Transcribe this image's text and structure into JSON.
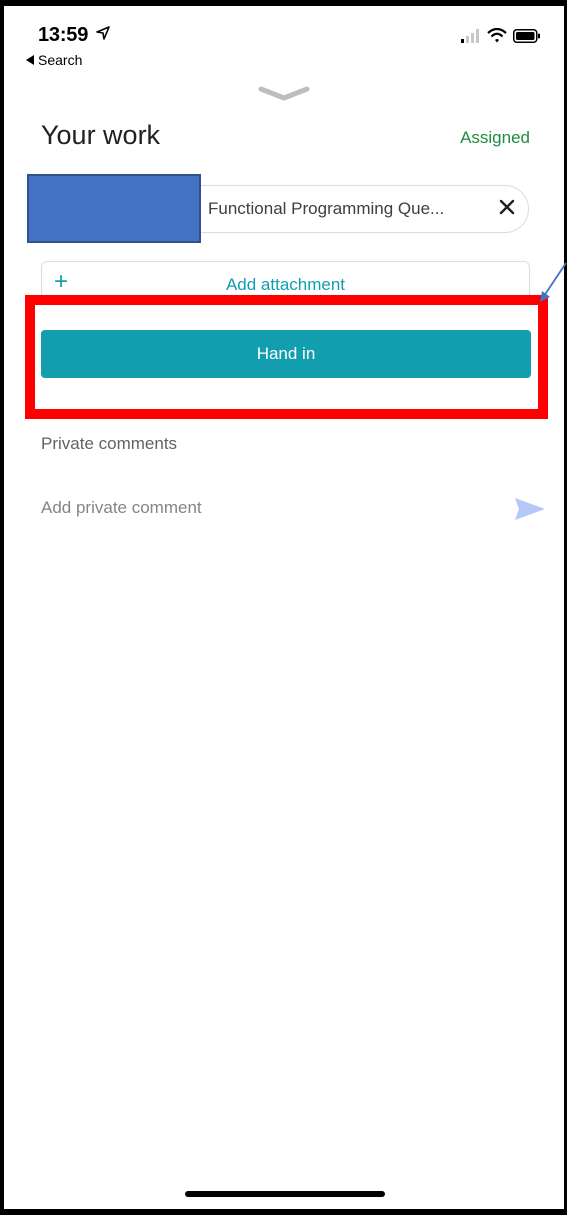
{
  "status_bar": {
    "time": "13:59",
    "back_label": "Search"
  },
  "header": {
    "title": "Your work",
    "status": "Assigned",
    "status_color": "#1e8e3e"
  },
  "attachment_chip": {
    "label": "Functional Programming Que...",
    "close_icon": "close-icon"
  },
  "add_attachment": {
    "icon": "+",
    "label": "Add attachment"
  },
  "actions": {
    "hand_in_label": "Hand in",
    "accent_color": "#129eaf"
  },
  "comments": {
    "section_title": "Private comments",
    "placeholder": "Add private comment"
  },
  "annotation": {
    "highlight_color": "#ff0000"
  }
}
